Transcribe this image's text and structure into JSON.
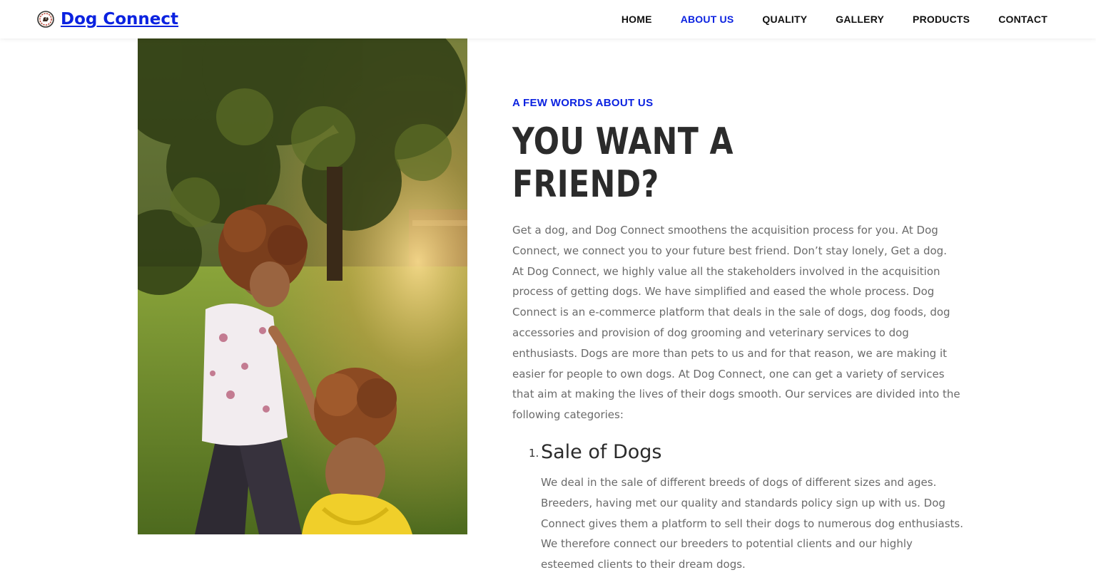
{
  "header": {
    "brand": "Dog Connect",
    "logo_icon": "dog-badge-icon",
    "nav": [
      {
        "label": "HOME",
        "active": false
      },
      {
        "label": "ABOUT US",
        "active": true
      },
      {
        "label": "QUALITY",
        "active": false
      },
      {
        "label": "GALLERY",
        "active": false
      },
      {
        "label": "PRODUCTS",
        "active": false
      },
      {
        "label": "CONTACT",
        "active": false
      }
    ]
  },
  "about": {
    "eyebrow": "A FEW WORDS ABOUT US",
    "title": "YOU WANT A FRIEND?",
    "intro": "Get a dog, and Dog Connect smoothens the acquisition process for you. At Dog Connect, we connect you to your future best friend. Don’t stay lonely, Get a dog. At Dog Connect, we highly value all the stakeholders involved in the acquisition process of getting dogs. We have simplified and eased the whole process. Dog Connect is an e-commerce platform that deals in the sale of dogs, dog foods, dog accessories and provision of dog grooming and veterinary services to dog enthusiasts. Dogs are more than pets to us and for that reason, we are making it easier for people to own dogs. At Dog Connect, one can get a variety of services that aim at making the lives of their dogs smooth. Our services are divided into the following categories:",
    "services": [
      {
        "number": "1.",
        "title": "Sale of Dogs",
        "body": "We deal in the sale of different breeds of dogs of different sizes and ages. Breeders, having met our quality and standards policy sign up with us. Dog Connect gives them a platform to sell their dogs to numerous dog enthusiasts. We therefore connect our breeders to potential clients and our highly esteemed clients to their dream dogs."
      }
    ]
  },
  "colors": {
    "accent": "#0b22e0",
    "heading": "#2b2b2b",
    "body_text": "#6a6a6a"
  }
}
